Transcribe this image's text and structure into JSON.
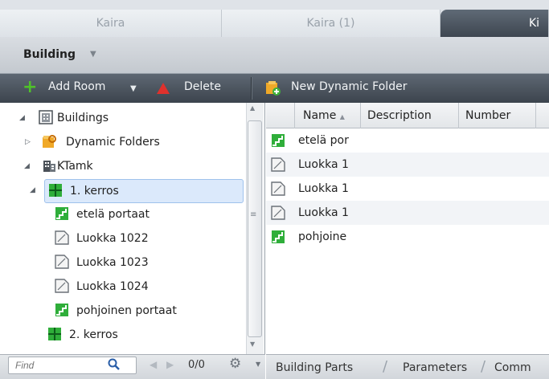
{
  "tabs": [
    {
      "label": "Kaira"
    },
    {
      "label": "Kaira (1)"
    },
    {
      "label": "Ki"
    }
  ],
  "building_bar": {
    "label": "Building"
  },
  "toolbar": {
    "add_room": "Add Room",
    "delete": "Delete",
    "new_dynamic_folder": "New Dynamic Folder"
  },
  "tree": {
    "items": [
      {
        "label": "Buildings",
        "icon": "buildings-icon"
      },
      {
        "label": "Dynamic Folders",
        "icon": "dynamic-folder-icon"
      },
      {
        "label": "KTamk",
        "icon": "building-icon"
      },
      {
        "label": "1. kerros",
        "icon": "floor-icon"
      },
      {
        "label": "etelä portaat",
        "icon": "stairs-icon"
      },
      {
        "label": "Luokka 1022",
        "icon": "room-icon"
      },
      {
        "label": "Luokka 1023",
        "icon": "room-icon"
      },
      {
        "label": "Luokka 1024",
        "icon": "room-icon"
      },
      {
        "label": "pohjoinen portaat",
        "icon": "stairs-icon"
      },
      {
        "label": "2. kerros",
        "icon": "floor-icon"
      }
    ]
  },
  "find": {
    "placeholder": "Find",
    "count": "0/0"
  },
  "grid": {
    "columns": [
      "Name",
      "Description",
      "Number"
    ],
    "rows": [
      {
        "name": "etelä por",
        "icon": "stairs-icon"
      },
      {
        "name": "Luokka 1",
        "icon": "room-icon"
      },
      {
        "name": "Luokka 1",
        "icon": "room-icon"
      },
      {
        "name": "Luokka 1",
        "icon": "room-icon"
      },
      {
        "name": "pohjoine",
        "icon": "stairs-icon"
      }
    ]
  },
  "bottom_tabs": [
    "Building Parts",
    "Parameters",
    "Comm"
  ]
}
